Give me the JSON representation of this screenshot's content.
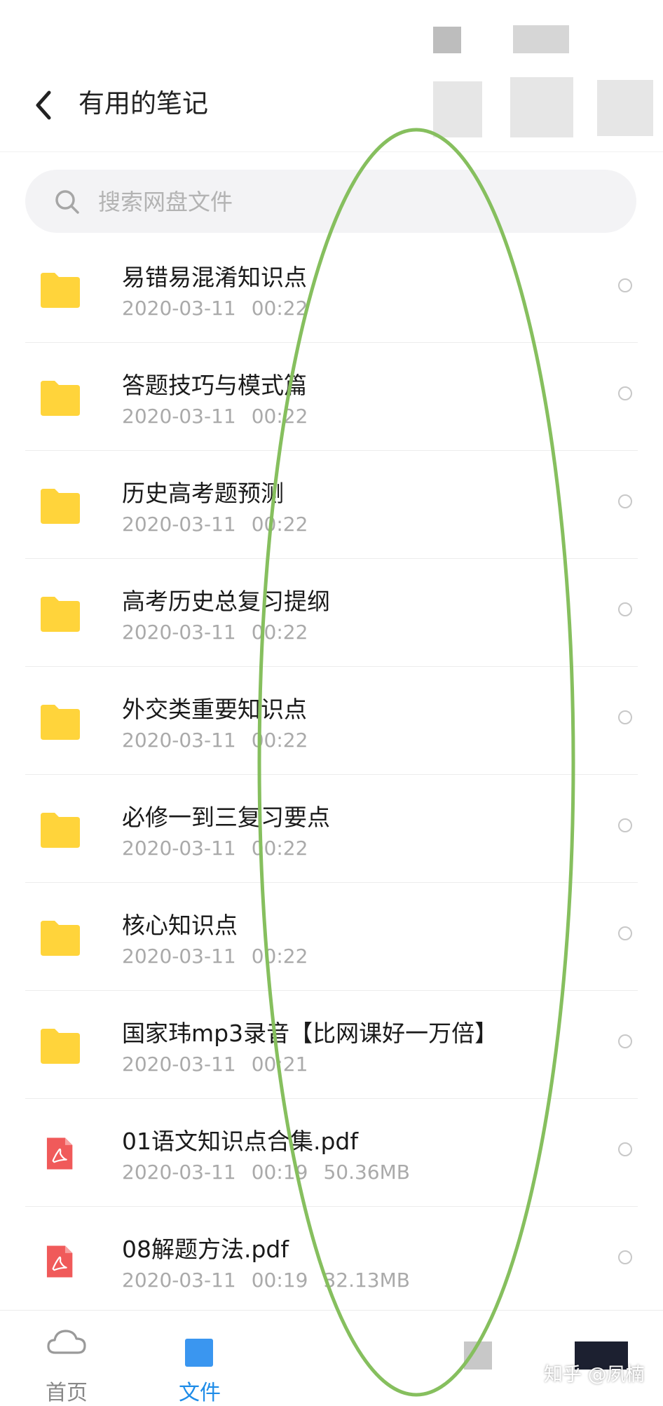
{
  "header": {
    "title": "有用的笔记"
  },
  "search": {
    "placeholder": "搜索网盘文件"
  },
  "files": [
    {
      "name": "易错易混淆知识点",
      "date": "2020-03-11",
      "time": "00:22",
      "size": "",
      "type": "folder"
    },
    {
      "name": "答题技巧与模式篇",
      "date": "2020-03-11",
      "time": "00:22",
      "size": "",
      "type": "folder"
    },
    {
      "name": "历史高考题预测",
      "date": "2020-03-11",
      "time": "00:22",
      "size": "",
      "type": "folder"
    },
    {
      "name": "高考历史总复习提纲",
      "date": "2020-03-11",
      "time": "00:22",
      "size": "",
      "type": "folder"
    },
    {
      "name": "外交类重要知识点",
      "date": "2020-03-11",
      "time": "00:22",
      "size": "",
      "type": "folder"
    },
    {
      "name": "必修一到三复习要点",
      "date": "2020-03-11",
      "time": "00:22",
      "size": "",
      "type": "folder"
    },
    {
      "name": "核心知识点",
      "date": "2020-03-11",
      "time": "00:22",
      "size": "",
      "type": "folder"
    },
    {
      "name": "国家玮mp3录音【比网课好一万倍】",
      "date": "2020-03-11",
      "time": "00:21",
      "size": "",
      "type": "folder"
    },
    {
      "name": "01语文知识点合集.pdf",
      "date": "2020-03-11",
      "time": "00:19",
      "size": "50.36MB",
      "type": "pdf"
    },
    {
      "name": "08解题方法.pdf",
      "date": "2020-03-11",
      "time": "00:19",
      "size": "32.13MB",
      "type": "pdf"
    }
  ],
  "bottom_nav": {
    "tabs": [
      {
        "label": "首页",
        "icon": "cloud-icon",
        "active": false
      },
      {
        "label": "文件",
        "icon": "files-icon",
        "active": true
      }
    ]
  },
  "watermark": "知乎 @夙楠",
  "colors": {
    "folder": "#FFD43B",
    "pdf": "#F05A5A",
    "accent": "#1E8CE8",
    "annotation": "#86BF5E"
  }
}
